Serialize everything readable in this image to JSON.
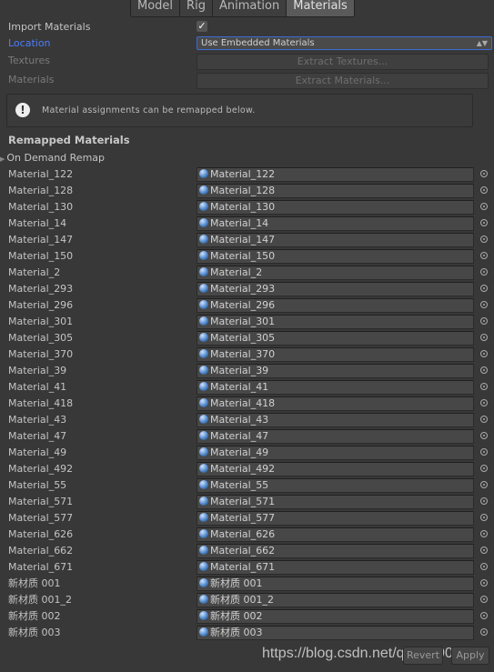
{
  "tabs": [
    {
      "label": "Model"
    },
    {
      "label": "Rig"
    },
    {
      "label": "Animation"
    },
    {
      "label": "Materials",
      "active": true
    }
  ],
  "import_materials": {
    "label": "Import Materials",
    "checked": true,
    "check_glyph": "✓"
  },
  "location": {
    "label": "Location",
    "value": "Use Embedded Materials",
    "accent": "#4c7dff"
  },
  "textures": {
    "label": "Textures",
    "button": "Extract Textures..."
  },
  "materials": {
    "label": "Materials",
    "button": "Extract Materials..."
  },
  "help": {
    "icon": "info-icon",
    "text": "Material assignments can be remapped below."
  },
  "remapped": {
    "title": "Remapped Materials",
    "on_demand": "On Demand Remap",
    "rows": [
      {
        "name": "Material_122",
        "value": "Material_122"
      },
      {
        "name": "Material_128",
        "value": "Material_128"
      },
      {
        "name": "Material_130",
        "value": "Material_130"
      },
      {
        "name": "Material_14",
        "value": "Material_14"
      },
      {
        "name": "Material_147",
        "value": "Material_147"
      },
      {
        "name": "Material_150",
        "value": "Material_150"
      },
      {
        "name": "Material_2",
        "value": "Material_2"
      },
      {
        "name": "Material_293",
        "value": "Material_293"
      },
      {
        "name": "Material_296",
        "value": "Material_296"
      },
      {
        "name": "Material_301",
        "value": "Material_301"
      },
      {
        "name": "Material_305",
        "value": "Material_305"
      },
      {
        "name": "Material_370",
        "value": "Material_370"
      },
      {
        "name": "Material_39",
        "value": "Material_39"
      },
      {
        "name": "Material_41",
        "value": "Material_41"
      },
      {
        "name": "Material_418",
        "value": "Material_418"
      },
      {
        "name": "Material_43",
        "value": "Material_43"
      },
      {
        "name": "Material_47",
        "value": "Material_47"
      },
      {
        "name": "Material_49",
        "value": "Material_49"
      },
      {
        "name": "Material_492",
        "value": "Material_492"
      },
      {
        "name": "Material_55",
        "value": "Material_55"
      },
      {
        "name": "Material_571",
        "value": "Material_571"
      },
      {
        "name": "Material_577",
        "value": "Material_577"
      },
      {
        "name": "Material_626",
        "value": "Material_626"
      },
      {
        "name": "Material_662",
        "value": "Material_662"
      },
      {
        "name": "Material_671",
        "value": "Material_671"
      },
      {
        "name": "新材质 001",
        "value": "新材质 001"
      },
      {
        "name": "新材质 001_2",
        "value": "新材质 001_2"
      },
      {
        "name": "新材质 002",
        "value": "新材质 002"
      },
      {
        "name": "新材质 003",
        "value": "新材质 003"
      }
    ]
  },
  "footer": {
    "revert": "Revert",
    "apply": "Apply"
  },
  "watermark": "https://blog.csdn.net/qq_49903862"
}
